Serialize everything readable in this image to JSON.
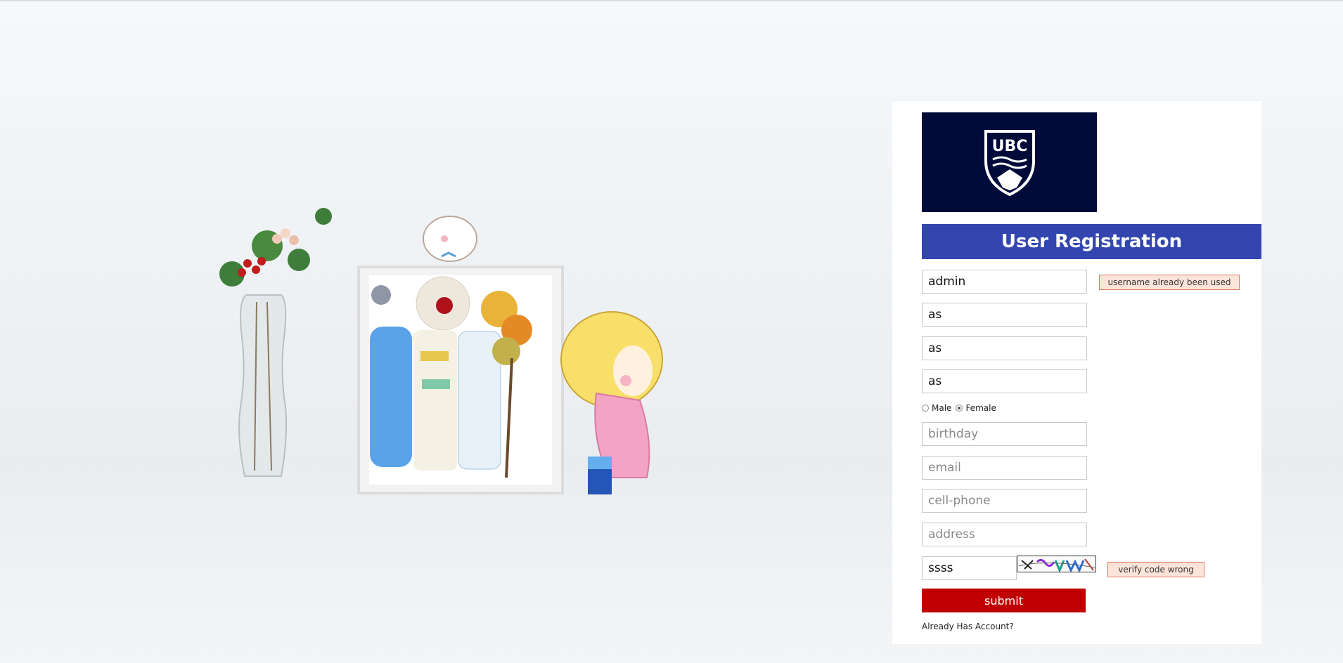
{
  "page": {
    "title": "User Registration",
    "brand": "UBC",
    "colors": {
      "title_bar": "#3346b0",
      "logo_bg": "#000b3a",
      "submit_bg": "#c00000",
      "error_bg": "#fde4da",
      "error_border": "#e07a5f"
    }
  },
  "form": {
    "username": {
      "value": "admin",
      "error": "username already been used"
    },
    "password": {
      "value": "as"
    },
    "confirm_password": {
      "value": "as"
    },
    "name": {
      "value": "as"
    },
    "gender": {
      "options": [
        "Male",
        "Female"
      ],
      "selected": "Female"
    },
    "birthday": {
      "value": "",
      "placeholder": "birthday"
    },
    "email": {
      "value": "",
      "placeholder": "email"
    },
    "cellphone": {
      "value": "",
      "placeholder": "cell-phone"
    },
    "address": {
      "value": "",
      "placeholder": "address"
    },
    "verify_code": {
      "value": "ssss",
      "error": "verify code wrong"
    },
    "submit_label": "submit",
    "login_link": "Already Has Account?"
  }
}
